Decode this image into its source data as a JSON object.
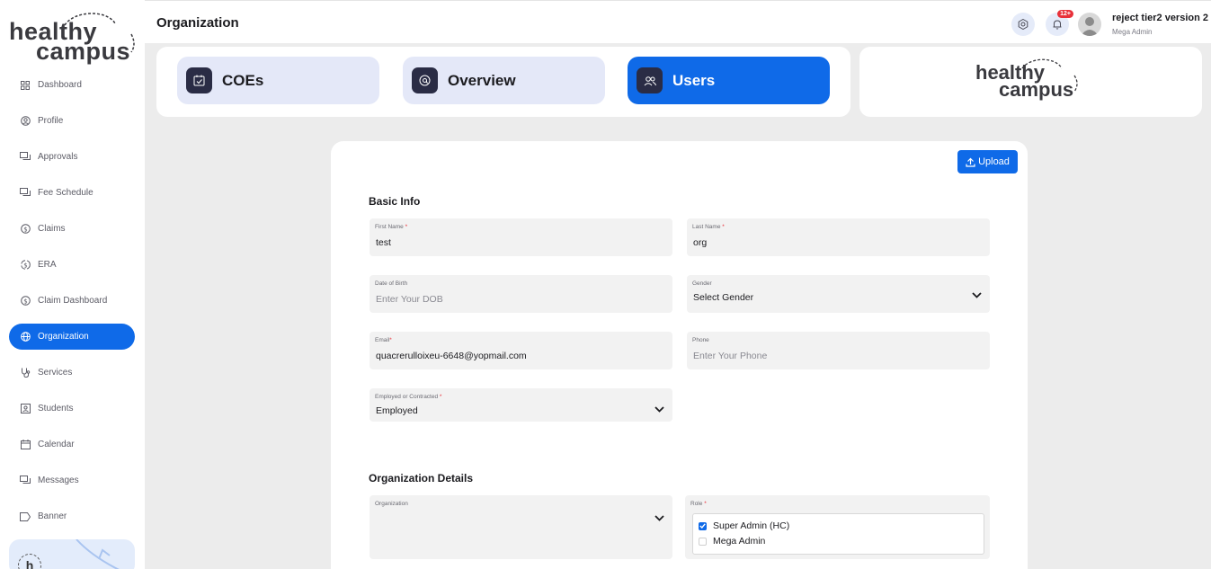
{
  "sidebar": {
    "logo": {
      "line1": "healthy",
      "line2": "campus"
    },
    "items": [
      {
        "label": "Dashboard",
        "icon": "grid-icon"
      },
      {
        "label": "Profile",
        "icon": "user-circle-icon"
      },
      {
        "label": "Approvals",
        "icon": "chat-icon"
      },
      {
        "label": "Fee Schedule",
        "icon": "chat-icon"
      },
      {
        "label": "Claims",
        "icon": "dollar-circle-icon"
      },
      {
        "label": "ERA",
        "icon": "dollar-cycle-icon"
      },
      {
        "label": "Claim Dashboard",
        "icon": "dollar-circle-icon"
      },
      {
        "label": "Organization",
        "icon": "globe-icon"
      },
      {
        "label": "Services",
        "icon": "stethoscope-icon"
      },
      {
        "label": "Students",
        "icon": "id-card-icon"
      },
      {
        "label": "Calendar",
        "icon": "calendar-icon"
      },
      {
        "label": "Messages",
        "icon": "chat-icon"
      },
      {
        "label": "Banner",
        "icon": "tag-icon"
      }
    ],
    "active_index": 7,
    "promo_badge": "h"
  },
  "topbar": {
    "title": "Organization",
    "notifications_count": "12+",
    "user_name": "reject tier2 version 2",
    "user_role": "Mega Admin"
  },
  "tabs": [
    {
      "label": "COEs",
      "icon": "calendar-check-icon",
      "active": false
    },
    {
      "label": "Overview",
      "icon": "user-at-icon",
      "active": false
    },
    {
      "label": "Users",
      "icon": "users-icon",
      "active": true
    }
  ],
  "brand": {
    "line1": "healthy",
    "line2": "campus"
  },
  "form": {
    "upload_label": "Upload",
    "basic_info_title": "Basic Info",
    "first_name": {
      "label": "First Name",
      "required_mark": "*",
      "value": "test"
    },
    "last_name": {
      "label": "Last Name",
      "required_mark": "*",
      "value": "org"
    },
    "dob": {
      "label": "Date of Birth",
      "placeholder": "Enter Your DOB"
    },
    "gender": {
      "label": "Gender",
      "value": "Select Gender"
    },
    "email": {
      "label": "Email",
      "required_mark": "*",
      "value": "quacrerulloixeu-6648@yopmail.com"
    },
    "phone": {
      "label": "Phone",
      "placeholder": "Enter Your Phone"
    },
    "employment": {
      "label": "Employed or Contracted",
      "required_mark": "*",
      "value": "Employed"
    },
    "org_details_title": "Organization Details",
    "organization": {
      "label": "Organization",
      "value": ""
    },
    "role": {
      "label": "Role",
      "required_mark": "*",
      "options": [
        {
          "label": "Super Admin (HC)",
          "checked": true
        },
        {
          "label": "Mega Admin",
          "checked": false
        }
      ]
    }
  },
  "colors": {
    "accent": "#0f6ae8",
    "tab_inactive": "#e4e8f8",
    "icon_tile": "#2a2c45",
    "badge": "#e8313a"
  }
}
